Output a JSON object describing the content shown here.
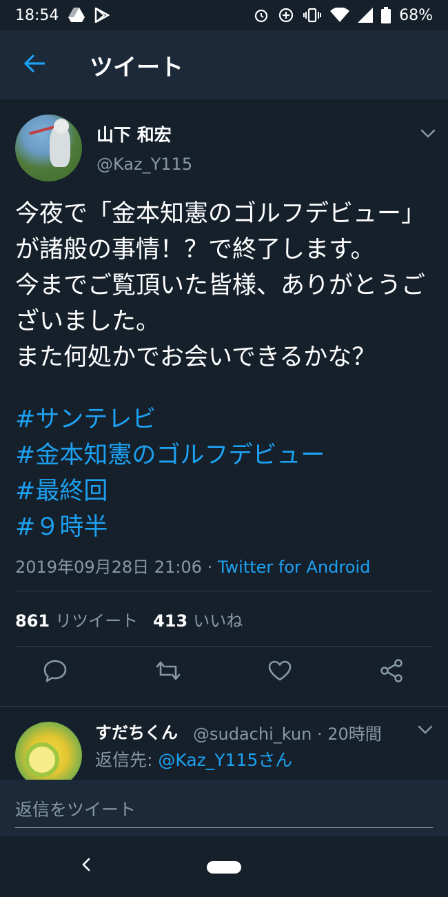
{
  "status_bar": {
    "time": "18:54",
    "battery": "68%",
    "icons": [
      "drive-icon",
      "play-store-icon",
      "alarm-icon",
      "data-saver-icon",
      "vibrate-icon",
      "wifi-icon",
      "signal-icon",
      "battery-icon"
    ]
  },
  "header": {
    "title": "ツイート",
    "back_icon": "arrow-left-icon"
  },
  "tweet": {
    "author_name": "山下 和宏",
    "author_handle": "@Kaz_Y115",
    "text": "今夜で「金本知憲のゴルフデビュー」が諸般の事情！？で終了します。\n今までご覧頂いた皆様、ありがとうございました。\nまた何処かでお会いできるかな？",
    "hashtags": [
      "#サンテレビ",
      "#金本知憲のゴルフデビュー",
      "#最終回",
      "#９時半"
    ],
    "timestamp": "2019年09月28日 21:06",
    "separator": " · ",
    "via": "Twitter for Android",
    "retweet_count": "861",
    "retweet_label": "リツイート",
    "like_count": "413",
    "like_label": "いいね",
    "accent_color": "#1da1f2"
  },
  "reply": {
    "name": "すだちくん",
    "handle": "@sudachi_kun · 20時間",
    "reply_to_label": "返信先: ",
    "reply_to_handle": "@Kaz_Y115さん",
    "text_preview": "..."
  },
  "reply_bar": {
    "placeholder": "返信をツイート"
  }
}
